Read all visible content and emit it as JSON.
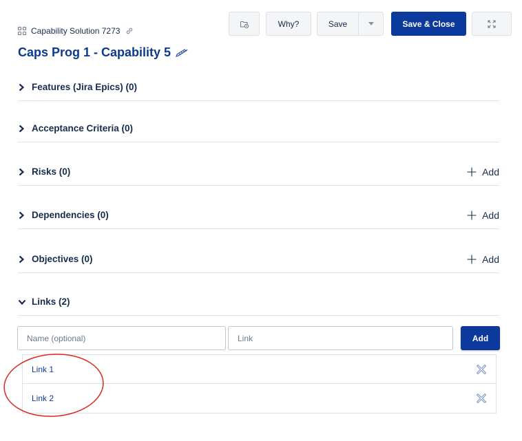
{
  "breadcrumb": {
    "text": "Capability Solution 7273"
  },
  "title": "Caps Prog 1 - Capability 5",
  "toolbar": {
    "why_label": "Why?",
    "save_label": "Save",
    "save_close_label": "Save & Close"
  },
  "sections": [
    {
      "label": "Features (Jira Epics) (0)",
      "expanded": false,
      "add_label": ""
    },
    {
      "label": "Acceptance Criteria (0)",
      "expanded": false,
      "add_label": ""
    },
    {
      "label": "Risks (0)",
      "expanded": false,
      "add_label": "Add"
    },
    {
      "label": "Dependencies (0)",
      "expanded": false,
      "add_label": "Add"
    },
    {
      "label": "Objectives (0)",
      "expanded": false,
      "add_label": "Add"
    },
    {
      "label": "Links (2)",
      "expanded": true,
      "add_label": ""
    }
  ],
  "links_form": {
    "name_placeholder": "Name (optional)",
    "link_placeholder": "Link",
    "add_label": "Add"
  },
  "links": [
    {
      "label": "Link 1"
    },
    {
      "label": "Link 2"
    }
  ],
  "colors": {
    "primary": "#0c3a9c",
    "title": "#0c3a8c",
    "annotation": "#d9281c"
  },
  "icons": [
    "grid-icon",
    "link-icon",
    "edit-pencil-icon",
    "folder-clock-icon",
    "chevron-down-icon",
    "expand-icon",
    "chevron-right-icon",
    "plus-icon",
    "close-icon"
  ]
}
